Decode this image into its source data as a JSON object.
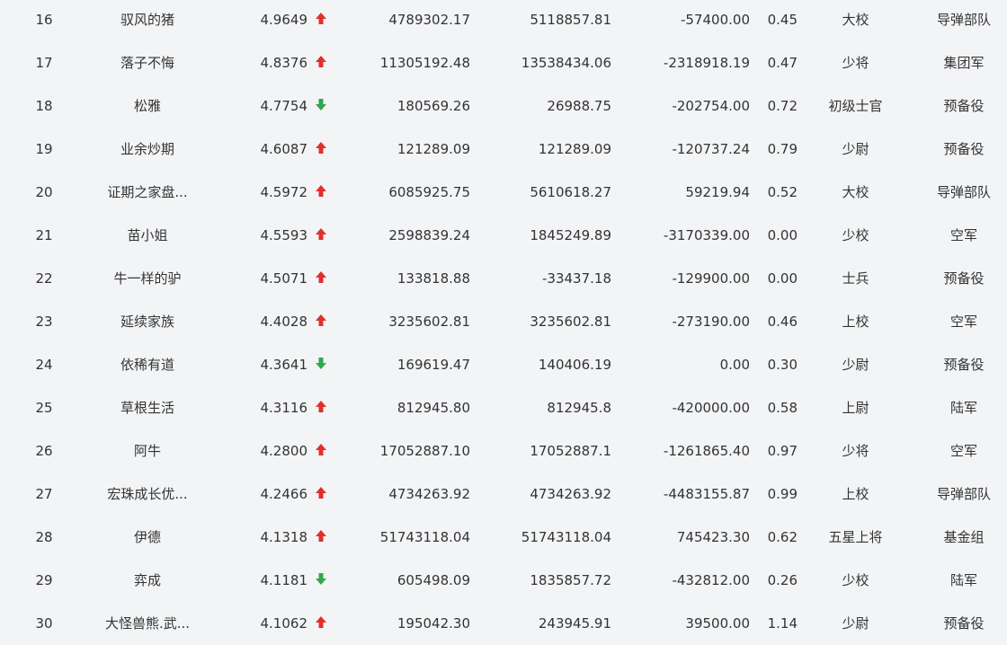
{
  "colors": {
    "up": "#e0302b",
    "down": "#2fa84f",
    "text": "#333333",
    "background": "#f3f4f6"
  },
  "rows": [
    {
      "rank": "16",
      "name": "驭风的猪",
      "score": "4.9649",
      "trend": "up",
      "v1": "4789302.17",
      "v2": "5118857.81",
      "v3": "-57400.00",
      "ratio": "0.45",
      "title": "大校",
      "unit": "导弹部队"
    },
    {
      "rank": "17",
      "name": "落子不悔",
      "score": "4.8376",
      "trend": "up",
      "v1": "11305192.48",
      "v2": "13538434.06",
      "v3": "-2318918.19",
      "ratio": "0.47",
      "title": "少将",
      "unit": "集团军"
    },
    {
      "rank": "18",
      "name": "松雅",
      "score": "4.7754",
      "trend": "down",
      "v1": "180569.26",
      "v2": "26988.75",
      "v3": "-202754.00",
      "ratio": "0.72",
      "title": "初级士官",
      "unit": "预备役"
    },
    {
      "rank": "19",
      "name": "业余炒期",
      "score": "4.6087",
      "trend": "up",
      "v1": "121289.09",
      "v2": "121289.09",
      "v3": "-120737.24",
      "ratio": "0.79",
      "title": "少尉",
      "unit": "预备役"
    },
    {
      "rank": "20",
      "name": "证期之家盘...",
      "score": "4.5972",
      "trend": "up",
      "v1": "6085925.75",
      "v2": "5610618.27",
      "v3": "59219.94",
      "ratio": "0.52",
      "title": "大校",
      "unit": "导弹部队"
    },
    {
      "rank": "21",
      "name": "苗小姐",
      "score": "4.5593",
      "trend": "up",
      "v1": "2598839.24",
      "v2": "1845249.89",
      "v3": "-3170339.00",
      "ratio": "0.00",
      "title": "少校",
      "unit": "空军"
    },
    {
      "rank": "22",
      "name": "牛一样的驴",
      "score": "4.5071",
      "trend": "up",
      "v1": "133818.88",
      "v2": "-33437.18",
      "v3": "-129900.00",
      "ratio": "0.00",
      "title": "士兵",
      "unit": "预备役"
    },
    {
      "rank": "23",
      "name": "延续家族",
      "score": "4.4028",
      "trend": "up",
      "v1": "3235602.81",
      "v2": "3235602.81",
      "v3": "-273190.00",
      "ratio": "0.46",
      "title": "上校",
      "unit": "空军"
    },
    {
      "rank": "24",
      "name": "依稀有道",
      "score": "4.3641",
      "trend": "down",
      "v1": "169619.47",
      "v2": "140406.19",
      "v3": "0.00",
      "ratio": "0.30",
      "title": "少尉",
      "unit": "预备役"
    },
    {
      "rank": "25",
      "name": "草根生活",
      "score": "4.3116",
      "trend": "up",
      "v1": "812945.80",
      "v2": "812945.8",
      "v3": "-420000.00",
      "ratio": "0.58",
      "title": "上尉",
      "unit": "陆军"
    },
    {
      "rank": "26",
      "name": "阿牛",
      "score": "4.2800",
      "trend": "up",
      "v1": "17052887.10",
      "v2": "17052887.1",
      "v3": "-1261865.40",
      "ratio": "0.97",
      "title": "少将",
      "unit": "空军"
    },
    {
      "rank": "27",
      "name": "宏珠成长优...",
      "score": "4.2466",
      "trend": "up",
      "v1": "4734263.92",
      "v2": "4734263.92",
      "v3": "-4483155.87",
      "ratio": "0.99",
      "title": "上校",
      "unit": "导弹部队"
    },
    {
      "rank": "28",
      "name": "伊德",
      "score": "4.1318",
      "trend": "up",
      "v1": "51743118.04",
      "v2": "51743118.04",
      "v3": "745423.30",
      "ratio": "0.62",
      "title": "五星上将",
      "unit": "基金组"
    },
    {
      "rank": "29",
      "name": "弈成",
      "score": "4.1181",
      "trend": "down",
      "v1": "605498.09",
      "v2": "1835857.72",
      "v3": "-432812.00",
      "ratio": "0.26",
      "title": "少校",
      "unit": "陆军"
    },
    {
      "rank": "30",
      "name": "大怪兽熊.武...",
      "score": "4.1062",
      "trend": "up",
      "v1": "195042.30",
      "v2": "243945.91",
      "v3": "39500.00",
      "ratio": "1.14",
      "title": "少尉",
      "unit": "预备役"
    }
  ]
}
